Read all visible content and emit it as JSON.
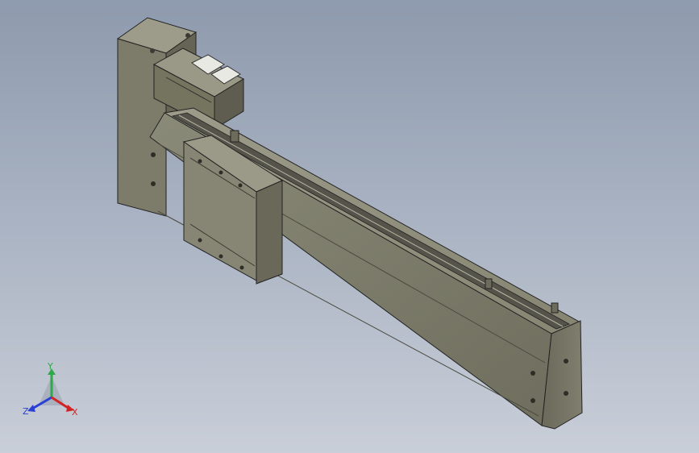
{
  "viewport": {
    "background_top": "#8e9aad",
    "background_bottom": "#c9ced8"
  },
  "model": {
    "body_color": "#7b7a69",
    "edge_color": "#1f1f1a"
  },
  "triad": {
    "y_label": "Y",
    "z_label": "Z",
    "x_label": "X",
    "y_color": "#2fa84a",
    "z_color": "#2a3fd6",
    "x_color": "#d22424"
  }
}
